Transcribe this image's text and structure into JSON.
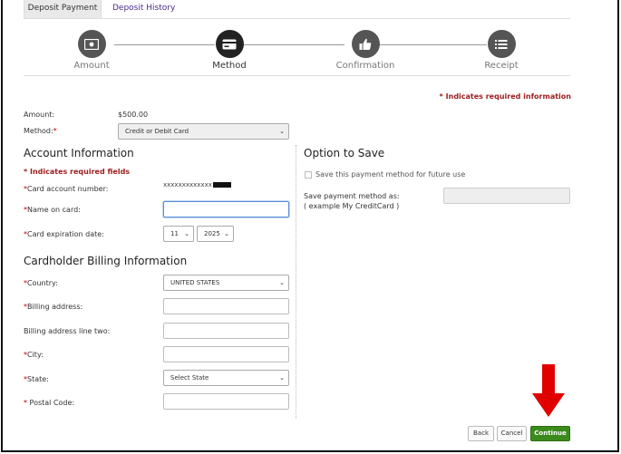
{
  "tabs": {
    "active": "Deposit Payment",
    "history": "Deposit History"
  },
  "steps": [
    {
      "label": "Amount"
    },
    {
      "label": "Method"
    },
    {
      "label": "Confirmation"
    },
    {
      "label": "Receipt"
    }
  ],
  "required_info": "* Indicates required information",
  "amount": {
    "label": "Amount:",
    "value": "$500.00"
  },
  "method": {
    "label": "Method:",
    "value": "Credit or Debit Card"
  },
  "account": {
    "heading": "Account Information",
    "req_fields": "* Indicates required fields",
    "card_number_label": "Card account number:",
    "card_number_value": "xxxxxxxxxxxxx",
    "name_label": "Name on card:",
    "expiry_label": "Card expiration date:",
    "expiry_month": "11",
    "expiry_year": "2025"
  },
  "billing": {
    "heading": "Cardholder Billing Information",
    "country_label": "Country:",
    "country_value": "UNITED STATES",
    "address_label": "Billing address:",
    "address2_label": "Billing address line two:",
    "city_label": "City:",
    "state_label": "State:",
    "state_value": "Select State",
    "postal_label": " Postal Code:"
  },
  "save": {
    "heading": "Option to Save",
    "checkbox_label": "Save this payment method for future use",
    "as_label": "Save payment method as:",
    "example": "( example My CreditCard )"
  },
  "buttons": {
    "back": "Back",
    "cancel": "Cancel",
    "continue": "Continue"
  },
  "colors": {
    "required": "#9b1c1c",
    "primary": "#3b8b1c",
    "arrow": "#e00000"
  }
}
